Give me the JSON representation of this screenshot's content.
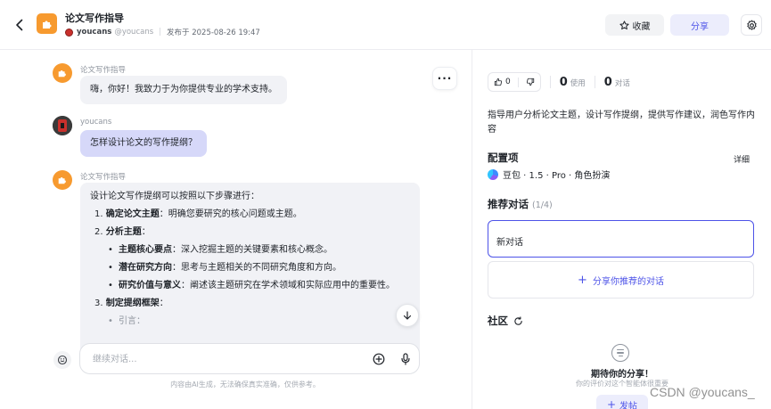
{
  "header": {
    "agent_name": "论文写作指导",
    "author_name": "youcans",
    "author_handle": "@youcans",
    "published": "发布于 2025-08-26 19:47",
    "favorite_label": "收藏",
    "share_label": "分享"
  },
  "chat": {
    "bot_name": "论文写作指导",
    "user_name": "youcans",
    "greeting": "嗨，你好！我致力于为你提供专业的学术支持。",
    "user_question": "怎样设计论文的写作提纲？",
    "answer": {
      "intro": "设计论文写作提纲可以按照以下步骤进行：",
      "steps": [
        {
          "num": "1. ",
          "title": "确定论文主题",
          "text": "：明确您要研究的核心问题或主题。"
        },
        {
          "num": "2. ",
          "title": "分析主题",
          "text": "："
        },
        {
          "num": "3. ",
          "title": "制定提纲框架",
          "text": "："
        }
      ],
      "sub_points": [
        {
          "bullet": "•",
          "title": "主题核心要点",
          "text": "：深入挖掘主题的关键要素和核心概念。"
        },
        {
          "bullet": "•",
          "title": "潜在研究方向",
          "text": "：思考与主题相关的不同研究角度和方向。"
        },
        {
          "bullet": "•",
          "title": "研究价值与意义",
          "text": "：阐述该主题研究在学术领域和实际应用中的重要性。"
        }
      ],
      "tail_bullet": "•",
      "tail_text": "引言："
    },
    "input_placeholder": "继续对话...",
    "disclaimer": "内容由AI生成，无法确保真实准确，仅供参考。"
  },
  "sidebar": {
    "likes": "0",
    "uses_count": "0",
    "uses_label": "使用",
    "conversations_count": "0",
    "conversations_label": "对话",
    "description": "指导用户分析论文主题，设计写作提纲，提供写作建议，润色写作内容",
    "config_title": "配置项",
    "detail_link": "详细",
    "model": "豆包 · 1.5 · Pro · 角色扮演",
    "recommended_title": "推荐对话",
    "recommended_count": "(1/4)",
    "recommended_items": [
      "新对话"
    ],
    "share_recommended": "分享你推荐的对话",
    "community_title": "社区",
    "empty_title": "期待你的分享！",
    "empty_subtitle": "你的评价对这个智能体很重要",
    "post_label": "发帖"
  },
  "watermark": "CSDN @youcans_",
  "colors": {
    "accent": "#4d53e8",
    "agent_orange": "#f79a2f",
    "user_bubble": "#d6d8f9",
    "bot_bubble": "#f1f2f6"
  },
  "icons": [
    "back-arrow-icon",
    "puzzle-icon",
    "star-icon",
    "gear-icon",
    "more-icon",
    "arrow-down-icon",
    "broom-icon",
    "plus-circle-icon",
    "microphone-icon",
    "thumbs-up-icon",
    "thumbs-down-icon",
    "refresh-icon",
    "chat-bubble-icon"
  ]
}
